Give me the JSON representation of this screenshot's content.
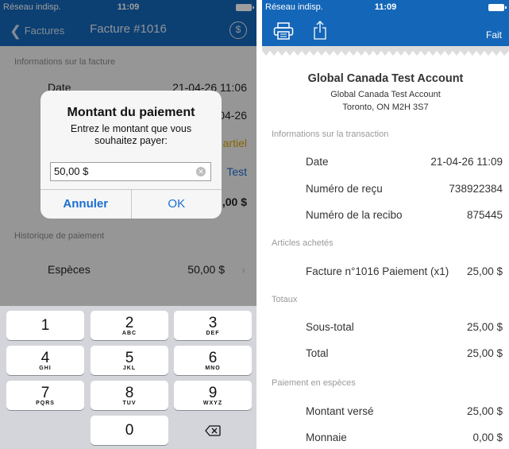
{
  "left": {
    "status": {
      "carrier": "Réseau indisp.",
      "time": "11:09"
    },
    "nav": {
      "back_label": "Factures",
      "title": "Facture #1016",
      "dollar": "$"
    },
    "info_header": "Informations sur la facture",
    "rows": [
      {
        "label": "Date",
        "value": "21-04-26 11:06"
      },
      {
        "label": "",
        "value": "04-26"
      },
      {
        "label": "",
        "value": "artiel"
      },
      {
        "label": "",
        "value": "Test"
      },
      {
        "label": "",
        "value": ",00 $"
      }
    ],
    "history_header": "Historique de paiement",
    "payment": {
      "method": "Espèces",
      "amount": "50,00 $"
    },
    "alert": {
      "title": "Montant du paiement",
      "message": "Entrez le montant que vous souhaitez payer:",
      "input_value": "50,00 $",
      "cancel": "Annuler",
      "ok": "OK"
    },
    "keyboard": {
      "keys": [
        {
          "num": "1",
          "letters": ""
        },
        {
          "num": "2",
          "letters": "ABC"
        },
        {
          "num": "3",
          "letters": "DEF"
        },
        {
          "num": "4",
          "letters": "GHI"
        },
        {
          "num": "5",
          "letters": "JKL"
        },
        {
          "num": "6",
          "letters": "MNO"
        },
        {
          "num": "7",
          "letters": "PQRS"
        },
        {
          "num": "8",
          "letters": "TUV"
        },
        {
          "num": "9",
          "letters": "WXYZ"
        },
        {
          "num": "0",
          "letters": ""
        }
      ],
      "delete_icon": "backspace-icon"
    }
  },
  "right": {
    "status": {
      "carrier": "Réseau indisp.",
      "time": "11:09"
    },
    "nav": {
      "done_label": "Fait",
      "print_icon": "printer-icon",
      "share_icon": "share-icon"
    },
    "business": {
      "name": "Global Canada Test Account",
      "line1": "Global Canada Test Account",
      "line2": "Toronto, ON M2H 3S7"
    },
    "sections": {
      "transaction": "Informations sur la transaction",
      "items": "Articles achetés",
      "totals": "Totaux",
      "cash": "Paiement en espèces"
    },
    "transaction_rows": [
      {
        "label": "Date",
        "value": "21-04-26 11:09"
      },
      {
        "label": "Numéro de reçu",
        "value": "738922384"
      },
      {
        "label": "Numéro de la recibo",
        "value": "875445"
      }
    ],
    "item_rows": [
      {
        "label": "Facture n°1016 Paiement (x1)",
        "value": "25,00 $"
      }
    ],
    "total_rows": [
      {
        "label": "Sous-total",
        "value": "25,00 $"
      },
      {
        "label": "Total",
        "value": "25,00 $"
      }
    ],
    "cash_rows": [
      {
        "label": "Montant versé",
        "value": "25,00 $"
      },
      {
        "label": "Monnaie",
        "value": "0,00 $"
      }
    ]
  }
}
